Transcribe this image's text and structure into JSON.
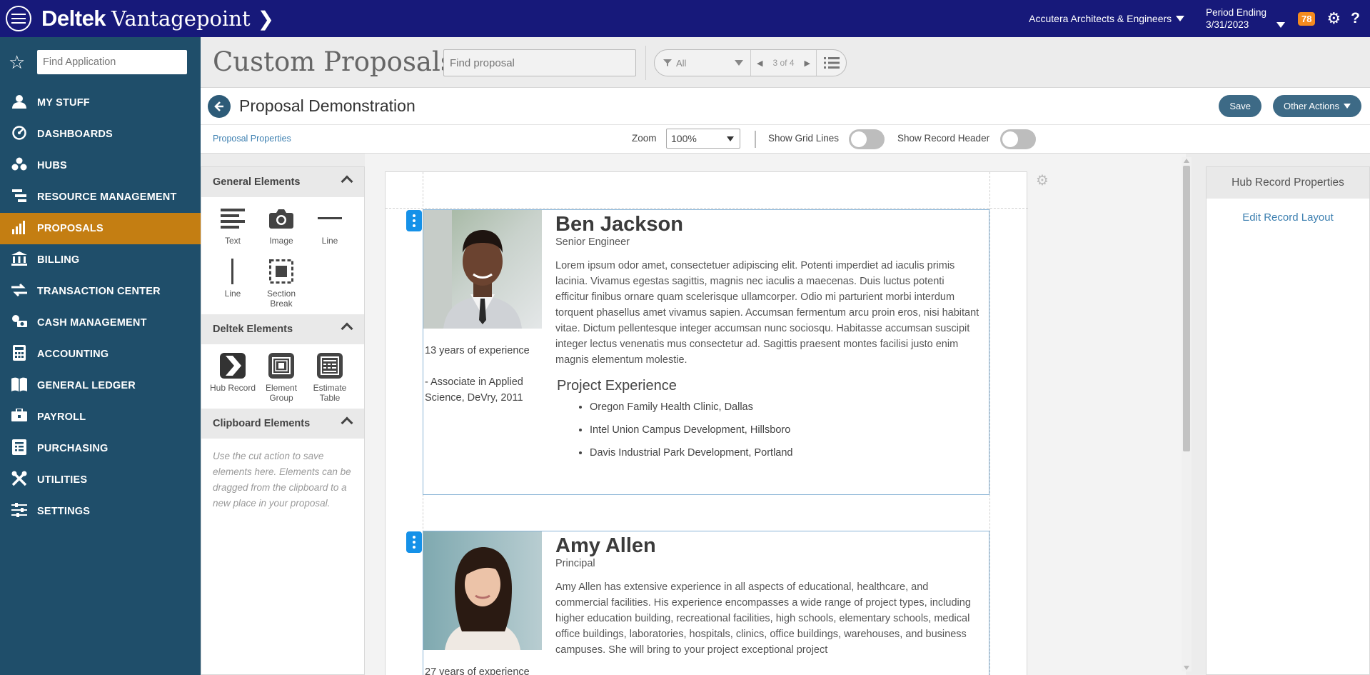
{
  "app": {
    "brand_bold": "Deltek",
    "brand_name": "Vantagepoint",
    "company": "Accutera Architects & Engineers",
    "period_label": "Period Ending",
    "period_date": "3/31/2023",
    "notifications": "78",
    "help": "?"
  },
  "nav": {
    "find_placeholder": "Find Application",
    "items": [
      {
        "label": "MY STUFF",
        "icon": "user-icon"
      },
      {
        "label": "DASHBOARDS",
        "icon": "dashboard-icon"
      },
      {
        "label": "HUBS",
        "icon": "hubs-icon"
      },
      {
        "label": "RESOURCE MANAGEMENT",
        "icon": "resource-icon"
      },
      {
        "label": "PROPOSALS",
        "icon": "bar-chart-icon",
        "active": true
      },
      {
        "label": "BILLING",
        "icon": "bank-icon"
      },
      {
        "label": "TRANSACTION CENTER",
        "icon": "arrows-icon"
      },
      {
        "label": "CASH MANAGEMENT",
        "icon": "cash-icon"
      },
      {
        "label": "ACCOUNTING",
        "icon": "calculator-icon"
      },
      {
        "label": "GENERAL LEDGER",
        "icon": "ledger-icon"
      },
      {
        "label": "PAYROLL",
        "icon": "payroll-icon"
      },
      {
        "label": "PURCHASING",
        "icon": "purchasing-icon"
      },
      {
        "label": "UTILITIES",
        "icon": "tools-icon"
      },
      {
        "label": "SETTINGS",
        "icon": "sliders-icon"
      }
    ]
  },
  "header": {
    "module_title": "Custom Proposals",
    "find_placeholder": "Find proposal",
    "filter_value": "All",
    "pager": "3 of 4"
  },
  "record": {
    "title": "Proposal Demonstration",
    "save_label": "Save",
    "other_actions_label": "Other Actions"
  },
  "toolbar": {
    "properties_link": "Proposal Properties",
    "zoom_label": "Zoom",
    "zoom_value": "100%",
    "grid_lines_label": "Show Grid Lines",
    "grid_lines_on": false,
    "record_header_label": "Show Record Header",
    "record_header_on": false
  },
  "elements_panel": {
    "general": {
      "title": "General Elements",
      "items": [
        {
          "label": "Text",
          "icon": "text-icon"
        },
        {
          "label": "Image",
          "icon": "camera-icon"
        },
        {
          "label": "Line",
          "icon": "horizontal-line-icon"
        },
        {
          "label": "Line",
          "icon": "vertical-line-icon"
        },
        {
          "label": "Section Break",
          "icon": "section-break-icon"
        }
      ]
    },
    "deltek": {
      "title": "Deltek Elements",
      "items": [
        {
          "label": "Hub Record",
          "icon": "hub-record-icon"
        },
        {
          "label": "Element Group",
          "icon": "element-group-icon"
        },
        {
          "label": "Estimate Table",
          "icon": "estimate-table-icon"
        }
      ]
    },
    "clipboard": {
      "title": "Clipboard Elements",
      "note": "Use the cut action to save elements here. Elements can be dragged from the clipboard to a new place in your proposal."
    }
  },
  "people": [
    {
      "name": "Ben Jackson",
      "title": "Senior Engineer",
      "experience_years": "13 years of experience",
      "degree": "- Associate in Applied Science, DeVry, 2011",
      "bio": "Lorem ipsum odor amet, consectetuer adipiscing elit. Potenti imperdiet ad iaculis primis lacinia. Vivamus egestas sagittis, magnis nec iaculis a maecenas. Duis luctus potenti efficitur finibus ornare quam scelerisque ullamcorper. Odio mi parturient morbi interdum torquent phasellus amet vivamus sapien. Accumsan fermentum arcu proin eros, nisi habitant vitae. Dictum pellentesque integer accumsan nunc sociosqu. Habitasse accumsan suscipit integer lectus venenatis mus consectetur ad. Sagittis praesent montes facilisi justo enim magnis elementum molestie.",
      "project_heading": "Project Experience",
      "projects": [
        "Oregon Family Health Clinic, Dallas",
        "Intel Union Campus Development, Hillsboro",
        "Davis Industrial Park Development, Portland"
      ]
    },
    {
      "name": "Amy Allen",
      "title": "Principal",
      "experience_years": "27 years of experience",
      "bio": "Amy Allen has extensive experience in all aspects of educational, healthcare, and commercial facilities. His experience encompasses a wide range of project types, including higher education building, recreational facilities, high schools, elementary schools, medical office buildings, laboratories, hospitals, clinics, office buildings, warehouses, and business campuses. She will bring to your project exceptional project"
    }
  ],
  "right_panel": {
    "title": "Hub Record Properties",
    "edit_link": "Edit Record Layout"
  },
  "colors": {
    "topbar": "#17197a",
    "sidebar": "#1f4e6a",
    "active_nav": "#c47e12",
    "badge": "#f48b1f",
    "button": "#3d6a86",
    "link": "#3c7fb0",
    "record_handle": "#1591e8"
  }
}
